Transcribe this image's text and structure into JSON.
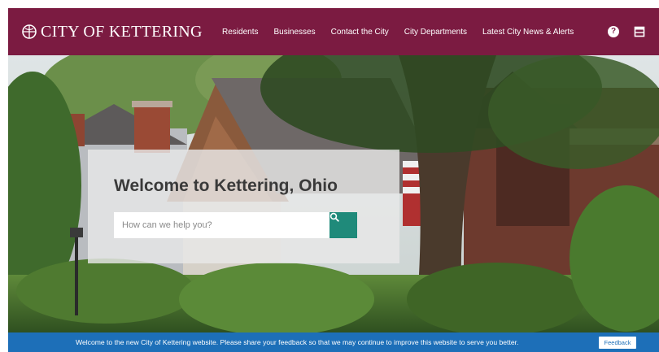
{
  "header": {
    "logo_text": "CITY OF KETTERING",
    "nav": [
      "Residents",
      "Businesses",
      "Contact the City",
      "City Departments",
      "Latest City News & Alerts"
    ],
    "help_icon": "question-circle-icon",
    "panel_icon": "panel-icon",
    "brand_color": "#7b1b41"
  },
  "hero": {
    "title": "Welcome to Kettering, Ohio",
    "search_placeholder": "How can we help you?",
    "search_icon": "search-icon",
    "accent_color": "#1f8a7a"
  },
  "feedback_bar": {
    "text": "Welcome to the new City of Kettering website. Please share your feedback so that we may continue to improve this website to serve you better.",
    "button_label": "Feedback",
    "color": "#1d6fb8"
  }
}
